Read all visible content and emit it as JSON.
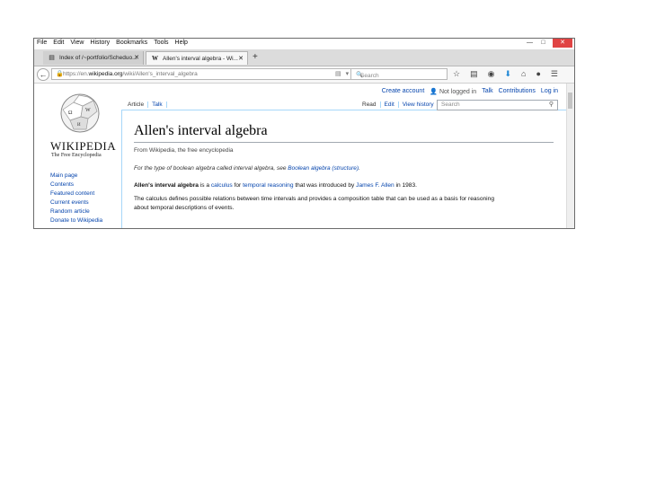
{
  "browser": {
    "menu": [
      "File",
      "Edit",
      "View",
      "History",
      "Bookmarks",
      "Tools",
      "Help"
    ],
    "window_buttons": {
      "minimize": "—",
      "maximize": "□",
      "close": "✕"
    },
    "tabs": [
      {
        "title": "Index of /~portfolio/Scheduo...",
        "icon": "file-icon",
        "active": false
      },
      {
        "title": "Allen's interval algebra - Wi...",
        "icon": "wikipedia-w-icon",
        "active": true
      }
    ],
    "new_tab_label": "+",
    "url_prefix": "https://en.",
    "url_domain": "wikipedia.org",
    "url_path": "/wiki/Allen's_interval_algebra",
    "search_placeholder": "Search",
    "toolbar_icons": [
      "star-icon",
      "bookmarks-icon",
      "pocket-icon",
      "download-icon",
      "home-icon",
      "chat-icon",
      "menu-icon"
    ],
    "accent": "#1f87d6"
  },
  "wiki": {
    "personal": {
      "create_account": "Create account",
      "not_logged_in": "Not logged in",
      "talk": "Talk",
      "contributions": "Contributions",
      "log_in": "Log in"
    },
    "wordmark": "WIKIPEDIA",
    "tagline": "The Free Encyclopedia",
    "nav": [
      "Main page",
      "Contents",
      "Featured content",
      "Current events",
      "Random article",
      "Donate to Wikipedia"
    ],
    "tabs_left": {
      "article": "Article",
      "talk": "Talk"
    },
    "tabs_right": {
      "read": "Read",
      "edit": "Edit",
      "history": "View history"
    },
    "search_placeholder": "Search",
    "title": "Allen's interval algebra",
    "from": "From Wikipedia, the free encyclopedia",
    "hatnote": {
      "prefix": "For the type of boolean algebra called interval algebra, see ",
      "link": "Boolean algebra (structure)",
      "suffix": "."
    },
    "para1": {
      "bold": "Allen's interval algebra",
      "t1": " is a ",
      "l1": "calculus",
      "t2": " for ",
      "l2": "temporal reasoning",
      "t3": " that was introduced by ",
      "l3": "James F. Allen",
      "t4": " in 1983."
    },
    "para2": {
      "line1": "The calculus defines possible relations between time intervals and provides a composition table that can be used as a basis for reasoning",
      "line2": "about temporal descriptions of events."
    },
    "link_color": "#0645ad"
  }
}
